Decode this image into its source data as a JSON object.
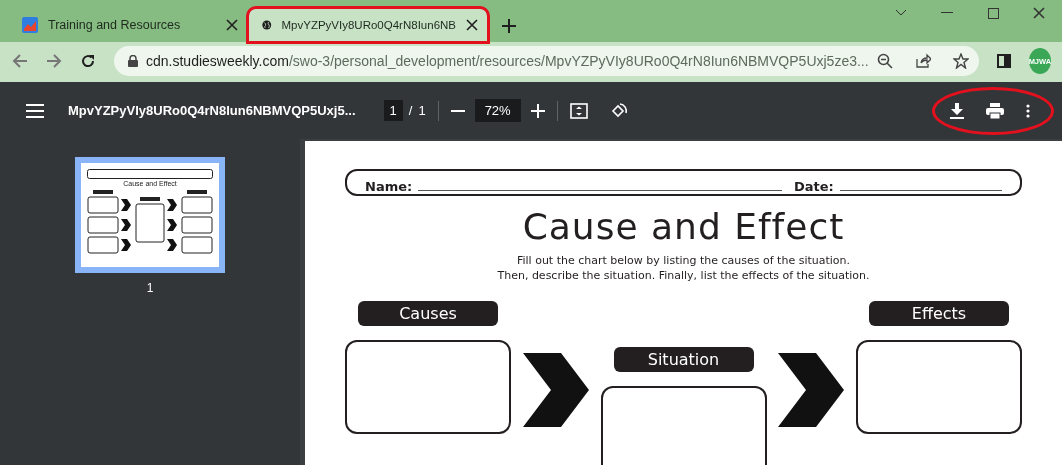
{
  "tabs": [
    {
      "title": "Training and Resources",
      "selected": false,
      "highlighted": false
    },
    {
      "title": "MpvYZPyVIy8URo0Q4rN8Iun6NB",
      "selected": true,
      "highlighted": true
    }
  ],
  "address_bar": {
    "domain": "cdn.studiesweekly.com",
    "path": "/swo-3/personal_development/resources/MpvYZPyVIy8URo0Q4rN8Iun6NBMVQP5Uxj5ze3..."
  },
  "profile": {
    "initials": "MJWA"
  },
  "pdf_toolbar": {
    "title": "MpvYZPyVIy8URo0Q4rN8Iun6NBMVQP5Uxj5...",
    "page": "1",
    "page_separator": "/",
    "page_count": "1",
    "zoom": "72%",
    "actions_highlighted": true
  },
  "sidebar": {
    "thumbnails": [
      {
        "label": "1",
        "title": "Cause and Effect",
        "selected": true
      }
    ]
  },
  "worksheet": {
    "name_label": "Name:",
    "date_label": "Date:",
    "title": "Cause and Effect",
    "instructions": [
      "Fill out the chart below by listing the causes of the situation.",
      "Then, describe the situation. Finally, list the effects of the situation."
    ],
    "causes_label": "Causes",
    "situation_label": "Situation",
    "effects_label": "Effects"
  }
}
